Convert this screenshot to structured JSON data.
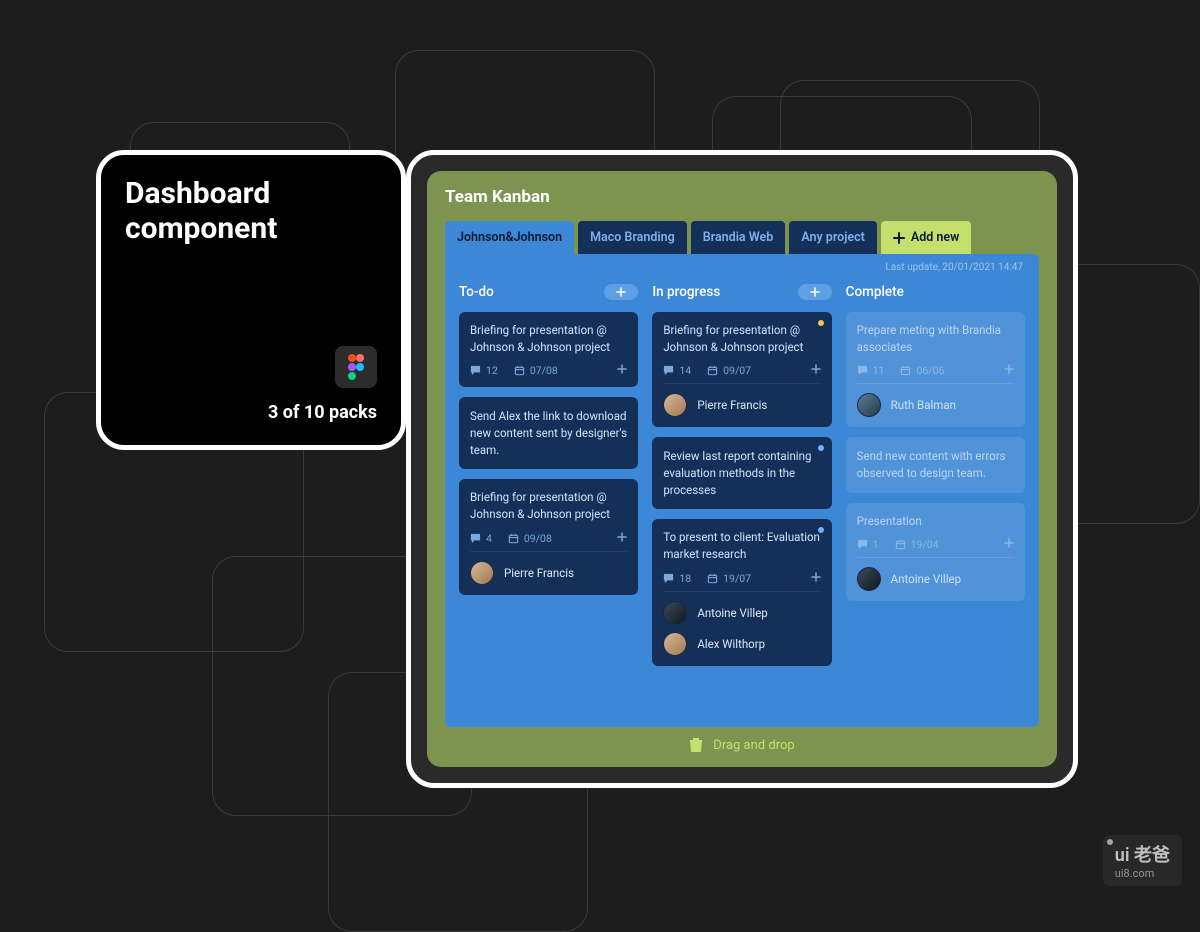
{
  "left_card": {
    "title_line1": "Dashboard",
    "title_line2": "component",
    "packs": "3 of 10 packs"
  },
  "kanban": {
    "title": "Team Kanban",
    "tabs": [
      {
        "label": "Johnson&Johnson",
        "active": true
      },
      {
        "label": "Maco Branding",
        "active": false
      },
      {
        "label": "Brandia Web",
        "active": false
      },
      {
        "label": "Any project",
        "active": false
      }
    ],
    "add_new_label": "Add new",
    "last_update": "Last update, 20/01/2021 14:47",
    "columns": {
      "todo": {
        "title": "To-do",
        "cards": [
          {
            "title": "Briefing for presentation @ Johnson & Johnson project",
            "comments": "12",
            "date": "07/08"
          },
          {
            "title": "Send Alex the link to download new content sent by designer's team."
          },
          {
            "title": "Briefing for presentation @ Johnson & Johnson project",
            "comments": "4",
            "date": "09/08",
            "assignee": "Pierre Francis"
          }
        ]
      },
      "in_progress": {
        "title": "In progress",
        "cards": [
          {
            "title": "Briefing for presentation @ Johnson & Johnson project",
            "comments": "14",
            "date": "09/07",
            "assignee": "Pierre Francis",
            "status": "yellow"
          },
          {
            "title": "Review last report containing evaluation methods in the processes",
            "status": "blue"
          },
          {
            "title": "To present to client: Evaluation market research",
            "comments": "18",
            "date": "19/07",
            "assignees": [
              "Antoine Villep",
              "Alex Wilthorp"
            ],
            "status": "blue"
          }
        ]
      },
      "complete": {
        "title": "Complete",
        "cards": [
          {
            "title": "Prepare meting with Brandia associates",
            "comments": "11",
            "date": "06/06",
            "assignee": "Ruth Balman"
          },
          {
            "title": "Send new content with errors observed to design team."
          },
          {
            "title": "Presentation",
            "comments": "1",
            "date": "19/04",
            "assignee": "Antoine Villep"
          }
        ]
      }
    },
    "drop_label": "Drag and drop"
  },
  "watermark": {
    "main": "ui 老爸",
    "sub": "ui8.com"
  }
}
